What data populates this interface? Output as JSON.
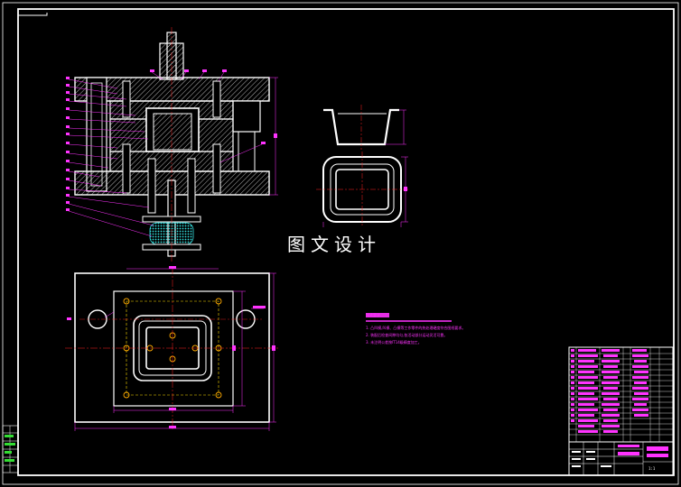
{
  "drawing": {
    "watermark": "图文设计",
    "colors": {
      "background": "#000000",
      "outline": "#ffffff",
      "hatch": "#ffffff",
      "centerline": "#ff2020",
      "dimension": "#ff33ff",
      "hidden": "#ffdd00",
      "spring": "#33dddd",
      "frame": "#ffffff"
    },
    "notes": {
      "title": "技术要求",
      "lines": [
        "1. 凸凹模,凹模、凸模等工作零件的热处理硬度符合图纸要求。",
        "2. 装配后检查间隙均匀,各活动部分运动灵活可靠。",
        "3. 未注明公差按IT14级精度加工。"
      ]
    },
    "title_block": {
      "scale": "1:1"
    }
  }
}
